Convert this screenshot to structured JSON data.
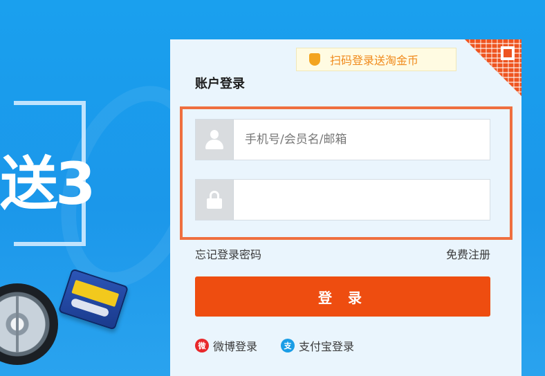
{
  "banner": {
    "text": "送3"
  },
  "login_panel": {
    "promo": {
      "icon": "shield-icon",
      "text": "扫码登录送淘金币"
    },
    "qr_corner_icon": "qr-code-icon",
    "title": "账户登录",
    "username_field": {
      "icon": "user-icon",
      "placeholder": "手机号/会员名/邮箱",
      "value": ""
    },
    "password_field": {
      "icon": "lock-icon",
      "value": ""
    },
    "forgot_password": "忘记登录密码",
    "register": "免费注册",
    "login_button": "登 录",
    "alt_logins": [
      {
        "icon": "weibo-icon",
        "label": "微博登录"
      },
      {
        "icon": "alipay-icon",
        "label": "支付宝登录"
      }
    ]
  },
  "colors": {
    "background": "#1b97ea",
    "panel": "#eaf5fd",
    "highlight_frame": "#ef6f3f",
    "login_button": "#ee4d10",
    "promo_text": "#f08a1c"
  }
}
